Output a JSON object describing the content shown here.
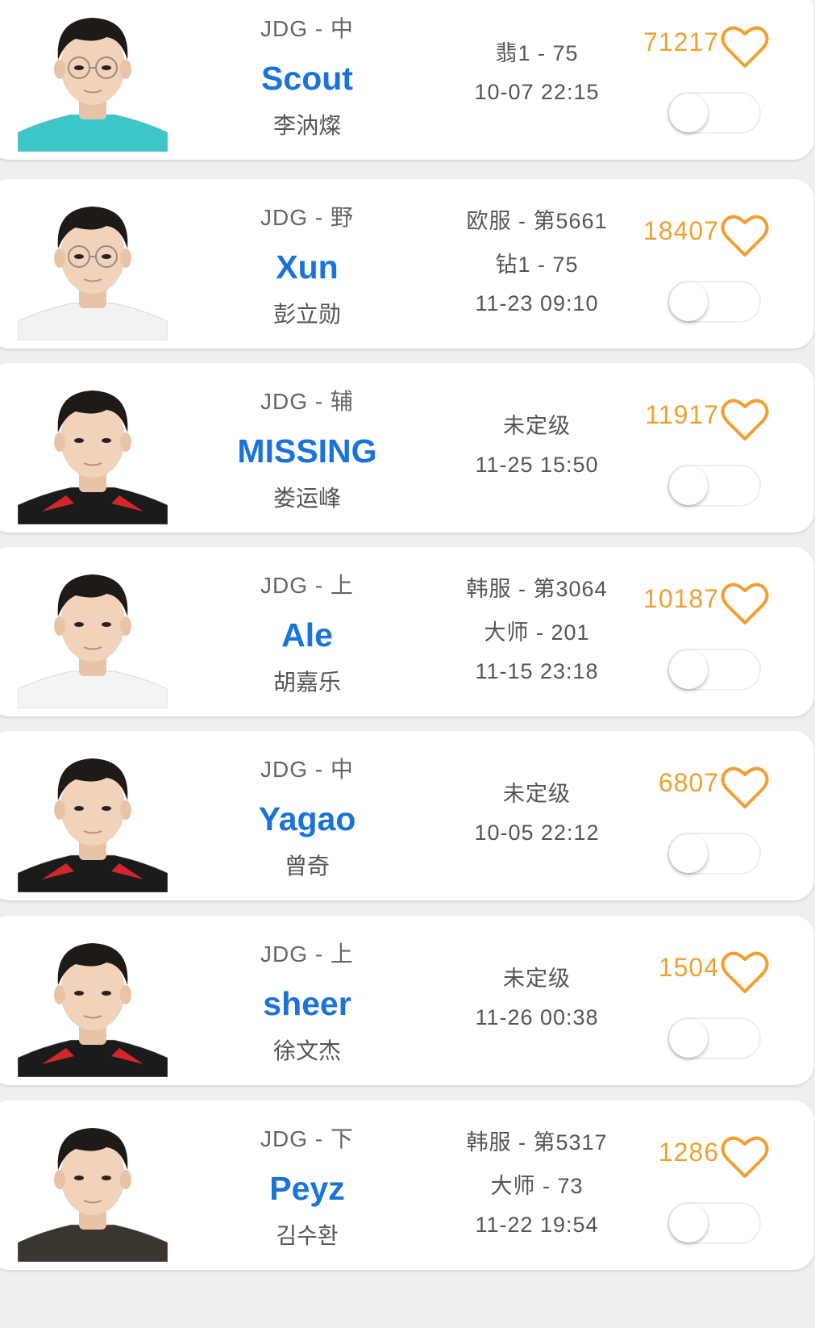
{
  "players": [
    {
      "team_role": "JDG - 中",
      "handle": "Scout",
      "real_name": "李汭燦",
      "rank_lines": [
        "翡1 - 75",
        "10-07 22:15"
      ],
      "likes": "71217",
      "avatar_icon": "player-photo",
      "jersey_color": "#3cc6c8",
      "glasses": true
    },
    {
      "team_role": "JDG - 野",
      "handle": "Xun",
      "real_name": "彭立勋",
      "rank_lines": [
        "欧服 - 第5661",
        "钻1 - 75",
        "11-23 09:10"
      ],
      "likes": "18407",
      "avatar_icon": "player-photo",
      "jersey_color": "#f2f2f2",
      "glasses": true
    },
    {
      "team_role": "JDG - 辅",
      "handle": "MISSING",
      "real_name": "娄运峰",
      "rank_lines": [
        "未定级",
        "11-25 15:50"
      ],
      "likes": "11917",
      "avatar_icon": "player-photo",
      "jersey_color": "#1b1b1b",
      "glasses": false
    },
    {
      "team_role": "JDG - 上",
      "handle": "Ale",
      "real_name": "胡嘉乐",
      "rank_lines": [
        "韩服 - 第3064",
        "大师 - 201",
        "11-15 23:18"
      ],
      "likes": "10187",
      "avatar_icon": "player-photo",
      "jersey_color": "#f4f4f4",
      "glasses": false
    },
    {
      "team_role": "JDG - 中",
      "handle": "Yagao",
      "real_name": "曾奇",
      "rank_lines": [
        "未定级",
        "10-05 22:12"
      ],
      "likes": "6807",
      "avatar_icon": "player-photo",
      "jersey_color": "#1b1b1b",
      "glasses": false
    },
    {
      "team_role": "JDG - 上",
      "handle": "sheer",
      "real_name": "徐文杰",
      "rank_lines": [
        "未定级",
        "11-26 00:38"
      ],
      "likes": "1504",
      "avatar_icon": "player-photo",
      "jersey_color": "#1b1b1b",
      "glasses": false
    },
    {
      "team_role": "JDG - 下",
      "handle": "Peyz",
      "real_name": "김수환",
      "rank_lines": [
        "韩服 - 第5317",
        "大师 - 73",
        "11-22 19:54"
      ],
      "likes": "1286",
      "avatar_icon": "player-photo",
      "jersey_color": "#3a352e",
      "glasses": false
    }
  ],
  "colors": {
    "handle": "#1a73d9",
    "likes": "#f0a030",
    "heart": "#f0a030"
  },
  "icons": {
    "like": "heart-outline-icon",
    "toggle": "toggle-switch-off"
  }
}
